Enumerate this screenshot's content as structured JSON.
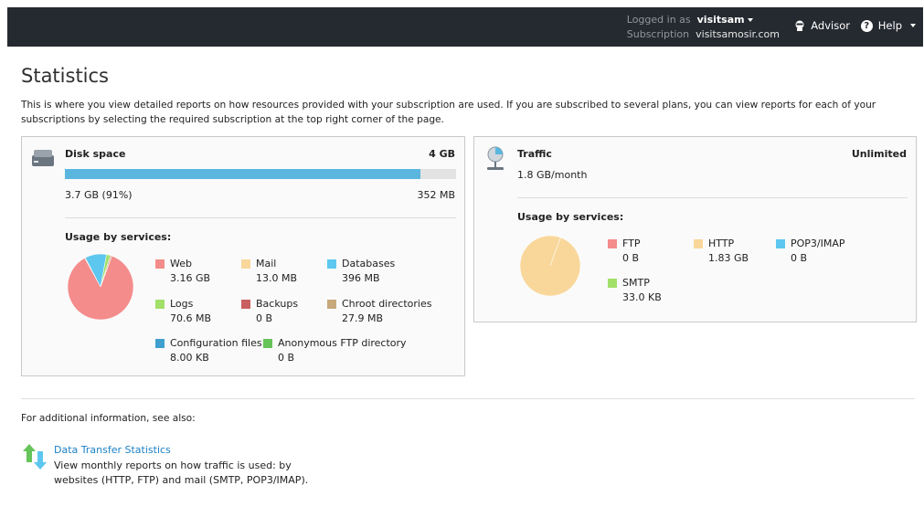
{
  "header": {
    "logged_in_label": "Logged in as",
    "username": "visitsam",
    "subscription_label": "Subscription",
    "subscription": "visitsamosir.com",
    "advisor": "Advisor",
    "help": "Help"
  },
  "page": {
    "title": "Statistics",
    "intro": "This is where you view detailed reports on how resources provided with your subscription are used. If you are subscribed to several plans, you can view reports for each of your subscriptions by selecting the required subscription at the top right corner of the page."
  },
  "disk": {
    "title": "Disk space",
    "limit": "4 GB",
    "used": "3.7 GB (91%)",
    "free": "352 MB",
    "usage_fraction": 0.91,
    "usage_heading": "Usage by services:",
    "services": [
      {
        "name": "Web",
        "value": "3.16 GB",
        "color": "#f48c8c"
      },
      {
        "name": "Mail",
        "value": "13.0 MB",
        "color": "#f9d79a"
      },
      {
        "name": "Databases",
        "value": "396 MB",
        "color": "#5ec7ef"
      },
      {
        "name": "Logs",
        "value": "70.6 MB",
        "color": "#a2e06a"
      },
      {
        "name": "Backups",
        "value": "0 B",
        "color": "#c96060"
      },
      {
        "name": "Chroot directories",
        "value": "27.9 MB",
        "color": "#c7a97c"
      },
      {
        "name": "Configuration files",
        "value": "8.00 KB",
        "color": "#3fa0cf"
      },
      {
        "name": "Anonymous FTP directory",
        "value": "0 B",
        "color": "#66c459"
      }
    ]
  },
  "traffic": {
    "title": "Traffic",
    "limit": "Unlimited",
    "used": "1.8 GB/month",
    "usage_heading": "Usage by services:",
    "services": [
      {
        "name": "FTP",
        "value": "0 B",
        "color": "#f48c8c"
      },
      {
        "name": "HTTP",
        "value": "1.83 GB",
        "color": "#f9d79a"
      },
      {
        "name": "POP3/IMAP",
        "value": "0 B",
        "color": "#5ec7ef"
      },
      {
        "name": "SMTP",
        "value": "33.0 KB",
        "color": "#a2e06a"
      }
    ]
  },
  "footer": {
    "see_also": "For additional information, see also:",
    "link_title": "Data Transfer Statistics",
    "link_desc": "View monthly reports on how traffic is used: by websites (HTTP, FTP) and mail (SMTP, POP3/IMAP)."
  },
  "colors": {
    "topbar": "#252a30",
    "accent": "#5ab6de",
    "link": "#1c81c6"
  }
}
